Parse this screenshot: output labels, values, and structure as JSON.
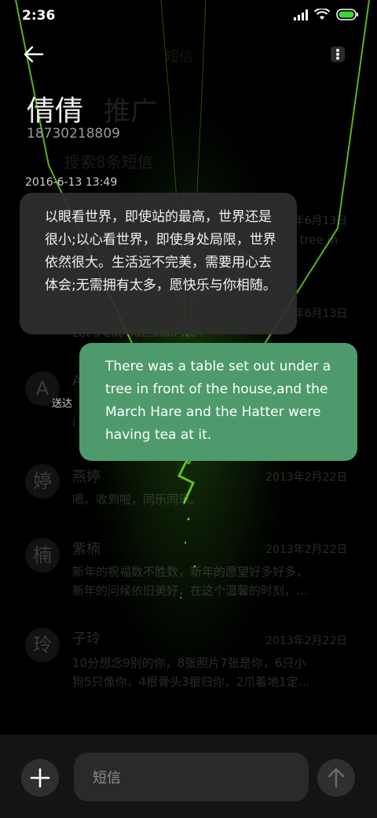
{
  "status_bar": {
    "time": "2:36"
  },
  "header": {
    "contact_name": "倩倩",
    "contact_number": "18730218809",
    "title_ghost": "短信",
    "promo_ghost": "推广",
    "search_ghost": "搜索8条短信"
  },
  "conversation": {
    "date": "2016-6-13 13:49",
    "incoming_text": "以眼看世界，即使站的最高，世界还是很小;以心看世界，即使身处局限，世界依然很大。生活远不完美，需要用心去体会;无需拥有太多，愿快乐与你相随。",
    "sent_label": "送达",
    "outgoing_text": "There was a table set out under a tree in front of the house,and the March Hare and the Hatter were having tea at it."
  },
  "background_list": [
    {
      "avatar": "",
      "name": "",
      "date": "2016年6月13日",
      "preview": "der a tree in"
    },
    {
      "avatar": "",
      "name": "",
      "date": "2016年6月13日",
      "preview": "Let's eat out,shall we?"
    },
    {
      "avatar": "A",
      "name": "A",
      "date": "",
      "preview": "i"
    },
    {
      "avatar": "婷",
      "name": "燕婷",
      "date": "2013年2月22日",
      "preview": "嗯。收到啦，同乐同乐。"
    },
    {
      "avatar": "楠",
      "name": "紫楠",
      "date": "2013年2月22日",
      "preview": "新年的祝福数不胜数，新年的愿望好多好多，",
      "preview2": "新年的问候依旧美好，在这个温馨的时刻，…"
    },
    {
      "avatar": "玲",
      "name": "子玲",
      "date": "2013年2月22日",
      "preview": "10分想念9别的你，8张照片7张是你，6只小",
      "preview2": "狗5只像你，4根骨头3根归你，2爪着地1定…"
    }
  ],
  "composer": {
    "placeholder": "短信"
  },
  "colors": {
    "accent_green": "#4e9a6d",
    "glow_green": "#6bd21a",
    "background": "#000000"
  },
  "icons": {
    "back": "arrow-left-icon",
    "more": "more-vertical-icon",
    "add": "plus-icon",
    "send": "arrow-up-icon",
    "signal": "signal-icon",
    "wifi": "wifi-icon",
    "battery": "battery-icon"
  }
}
